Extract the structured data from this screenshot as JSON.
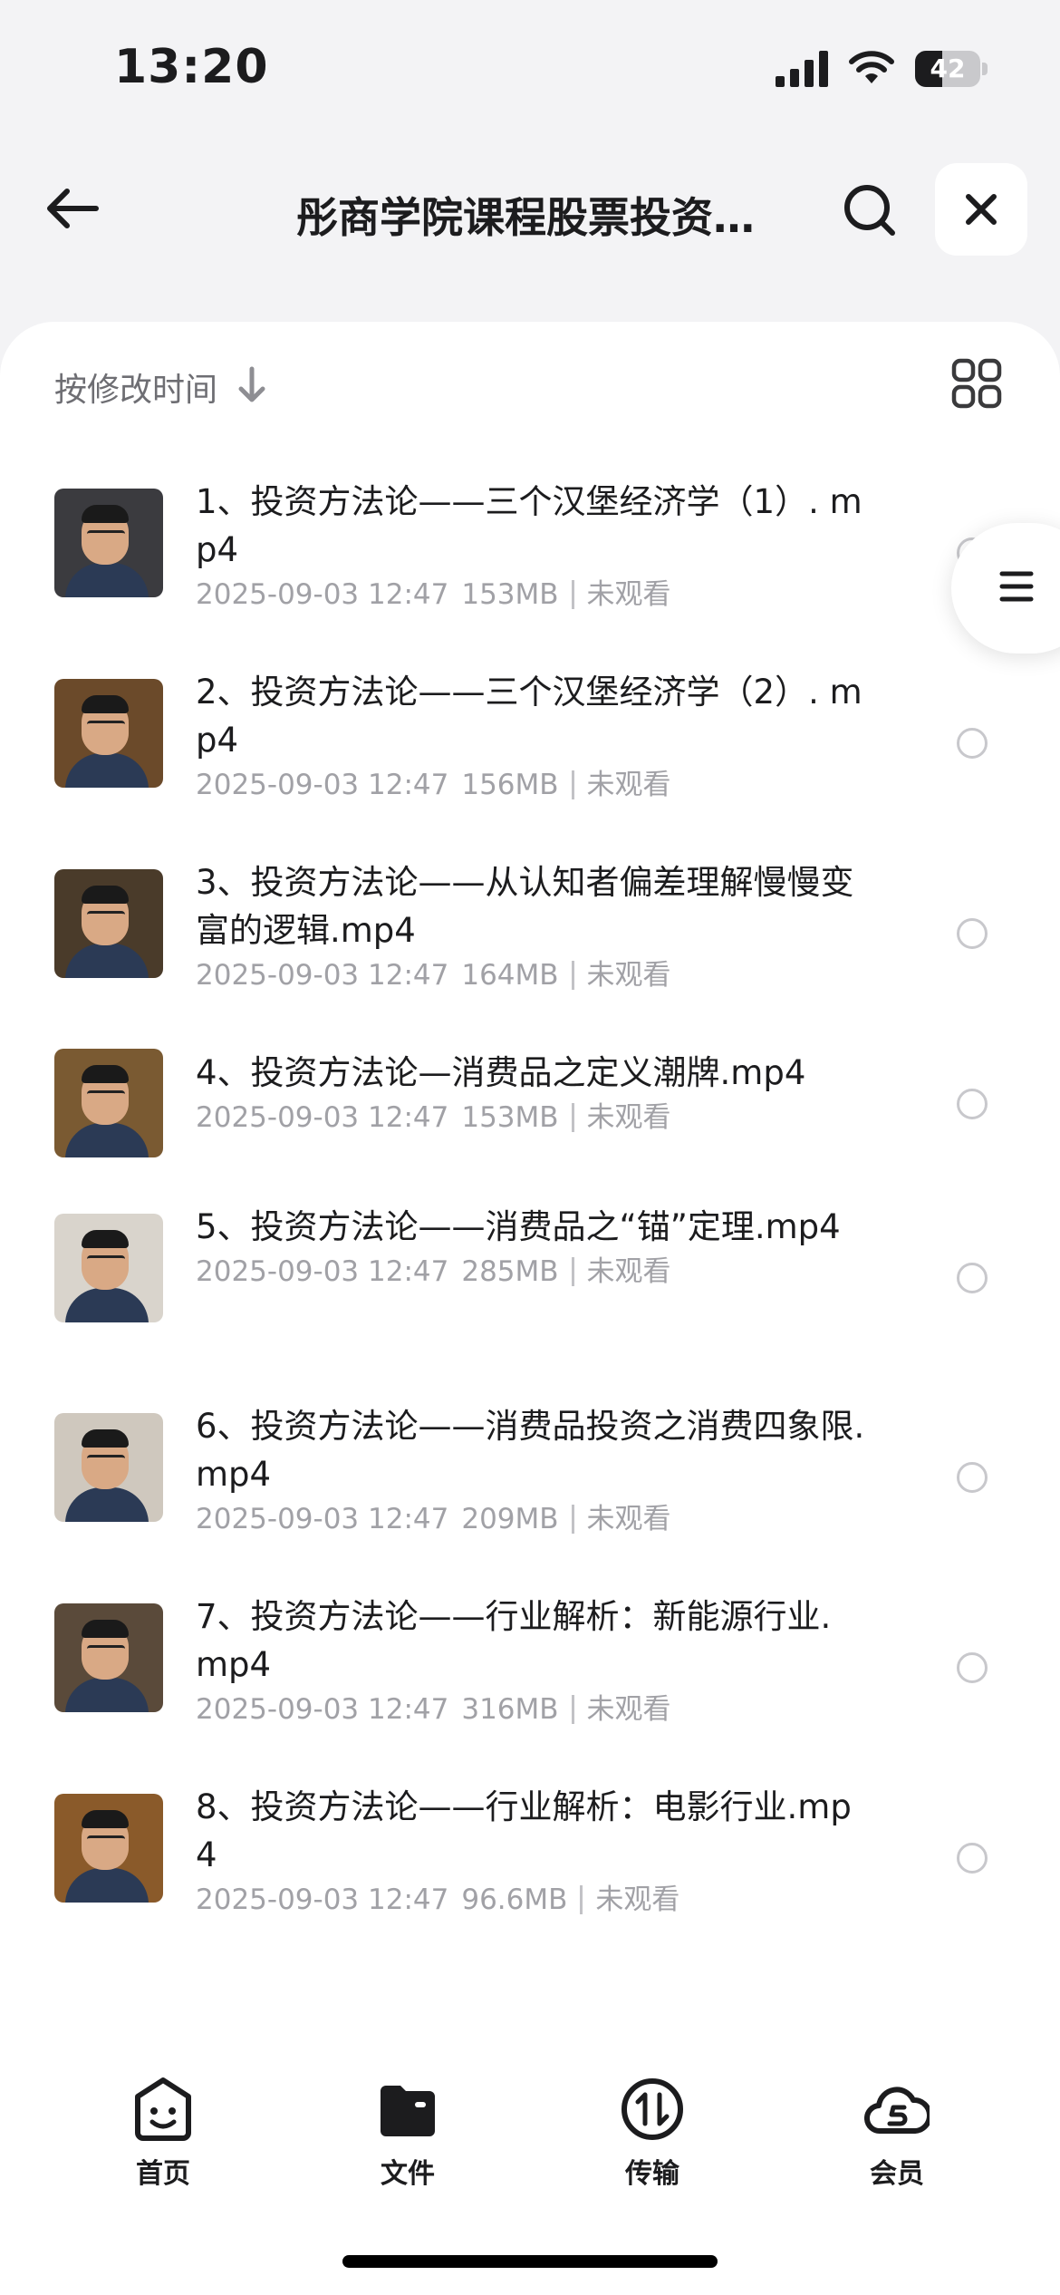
{
  "status": {
    "time": "13:20",
    "battery": "42",
    "battery_level": 0.42
  },
  "nav": {
    "title": "彤商学院课程股票投资…"
  },
  "sort": {
    "label": "按修改时间"
  },
  "files": [
    {
      "name": "1、投资方法论——三个汉堡经济学（1）. mp4",
      "date": "2025-09-03 12:47",
      "size": "153MB",
      "status": "未观看"
    },
    {
      "name": "2、投资方法论——三个汉堡经济学（2）. mp4",
      "date": "2025-09-03 12:47",
      "size": "156MB",
      "status": "未观看"
    },
    {
      "name": "3、投资方法论——从认知者偏差理解慢慢变富的逻辑.mp4",
      "date": "2025-09-03 12:47",
      "size": "164MB",
      "status": "未观看"
    },
    {
      "name": "4、投资方法论—消费品之定义潮牌.mp4",
      "date": "2025-09-03 12:47",
      "size": "153MB",
      "status": "未观看"
    },
    {
      "name": "5、投资方法论——消费品之“锚”定理.mp4",
      "date": "2025-09-03 12:47",
      "size": "285MB",
      "status": "未观看"
    },
    {
      "name": "6、投资方法论——消费品投资之消费四象限.mp4",
      "date": "2025-09-03 12:47",
      "size": "209MB",
      "status": "未观看"
    },
    {
      "name": "7、投资方法论——行业解析：新能源行业. mp4",
      "date": "2025-09-03 12:47",
      "size": "316MB",
      "status": "未观看"
    },
    {
      "name": "8、投资方法论——行业解析：电影行业.mp4",
      "date": "2025-09-03 12:47",
      "size": "96.6MB",
      "status": "未观看"
    }
  ],
  "tabs": [
    {
      "label": "首页",
      "icon": "home-face-icon"
    },
    {
      "label": "文件",
      "icon": "folder-icon"
    },
    {
      "label": "传输",
      "icon": "transfer-icon"
    },
    {
      "label": "会员",
      "icon": "cloud-member-icon"
    }
  ],
  "colors": {
    "background": "#f3f3f5",
    "card": "#ffffff",
    "meta_text": "#a1a1a6",
    "primary_text": "#1c1c1e"
  }
}
